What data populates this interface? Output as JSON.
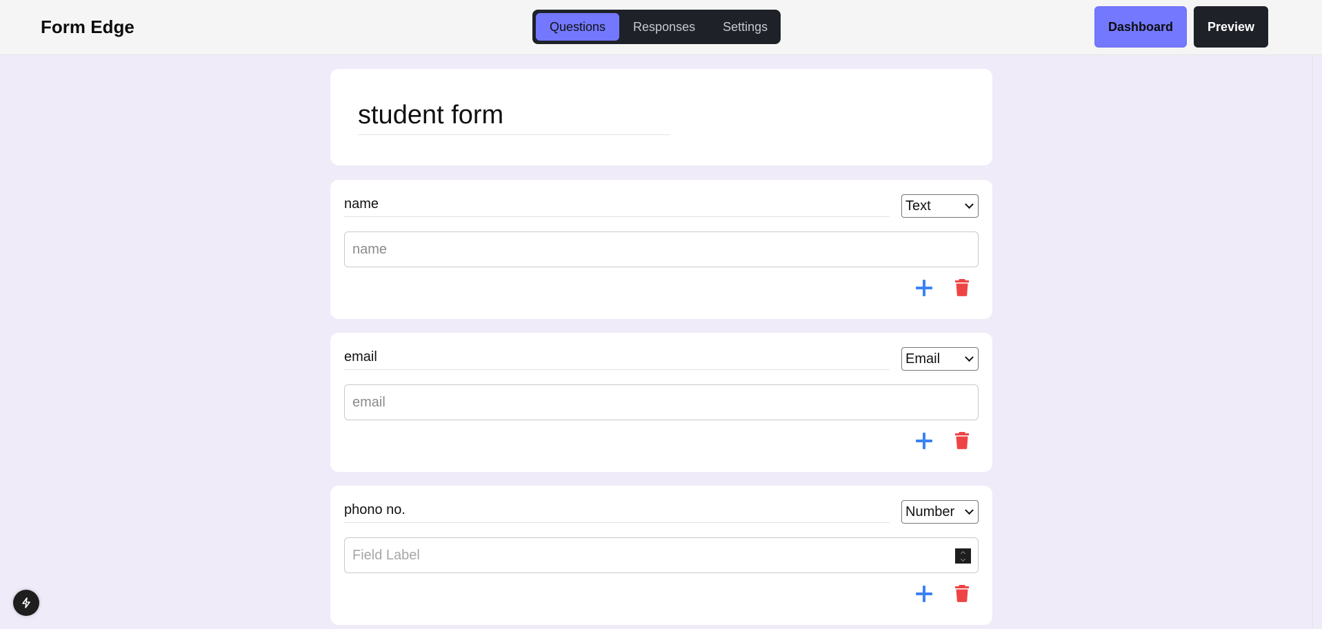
{
  "app": {
    "brand": "Form Edge"
  },
  "tabs": [
    {
      "label": "Questions",
      "active": true
    },
    {
      "label": "Responses",
      "active": false
    },
    {
      "label": "Settings",
      "active": false
    }
  ],
  "actions": {
    "dashboard": "Dashboard",
    "preview": "Preview"
  },
  "form": {
    "title": "student form",
    "questions": [
      {
        "label": "name",
        "type": "Text",
        "placeholder": "name"
      },
      {
        "label": "email",
        "type": "Email",
        "placeholder": "email"
      },
      {
        "label": "phono no.",
        "type": "Number",
        "placeholder": "Field Label"
      }
    ]
  },
  "colors": {
    "accent": "#7378ff",
    "dark": "#1e2128",
    "add": "#3b82f6",
    "delete": "#ef4444",
    "background": "#efebf8"
  },
  "icons": {
    "add": "plus-icon",
    "delete": "trash-icon",
    "devtools": "bolt-icon"
  }
}
